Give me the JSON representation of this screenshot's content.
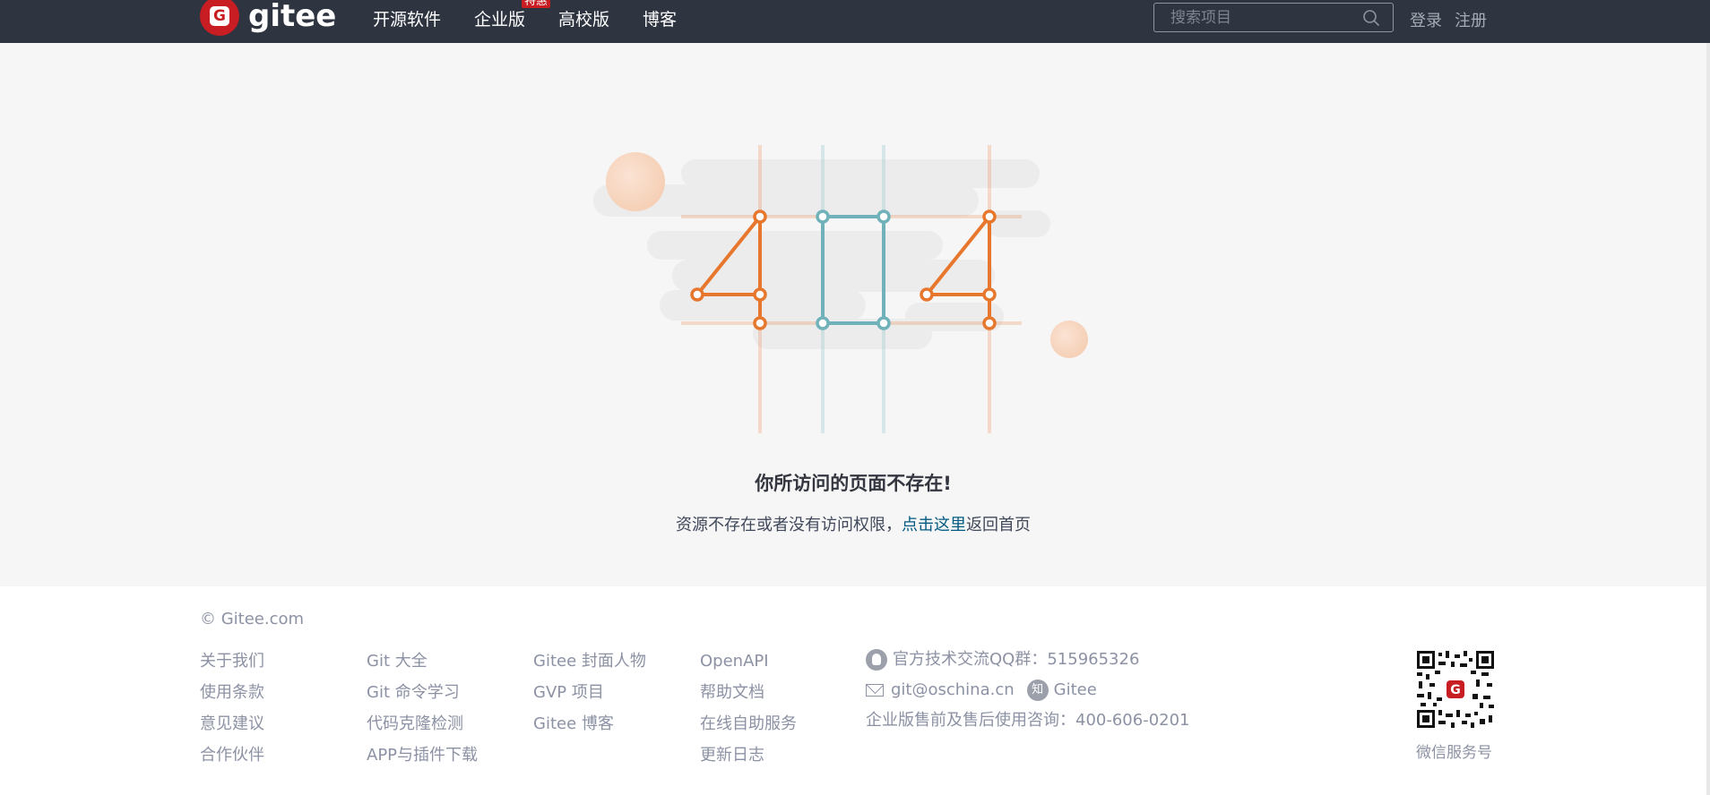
{
  "header": {
    "brand": "gitee",
    "logo_letter": "G",
    "nav": [
      {
        "label": "开源软件"
      },
      {
        "label": "企业版",
        "badge": "特惠"
      },
      {
        "label": "高校版"
      },
      {
        "label": "博客"
      }
    ],
    "search_placeholder": "搜索项目",
    "login_label": "登录",
    "register_label": "注册"
  },
  "error": {
    "code_digits": [
      "4",
      "0",
      "4"
    ],
    "title": "你所访问的页面不存在!",
    "desc_prefix": "资源不存在或者没有访问权限，",
    "desc_link": "点击这里",
    "desc_suffix": "返回首页"
  },
  "footer": {
    "copyright": "© Gitee.com",
    "columns": [
      [
        "关于我们",
        "使用条款",
        "意见建议",
        "合作伙伴"
      ],
      [
        "Git 大全",
        "Git 命令学习",
        "代码克隆检测",
        "APP与插件下载"
      ],
      [
        "Gitee 封面人物",
        "GVP 项目",
        "Gitee 博客"
      ],
      [
        "OpenAPI",
        "帮助文档",
        "在线自助服务",
        "更新日志"
      ]
    ],
    "qq_group": "官方技术交流QQ群：515965326",
    "email": "git@oschina.cn",
    "zhihu_icon_text": "知",
    "zhihu_label": "Gitee",
    "hotline": "企业版售前及售后使用咨询：400-606-0201",
    "qr_label": "微信服务号"
  },
  "colors": {
    "header_bg": "#2e3440",
    "brand_red": "#c71d23",
    "orange": "#e8772e",
    "teal": "#6fb2ba",
    "link": "#005980"
  }
}
